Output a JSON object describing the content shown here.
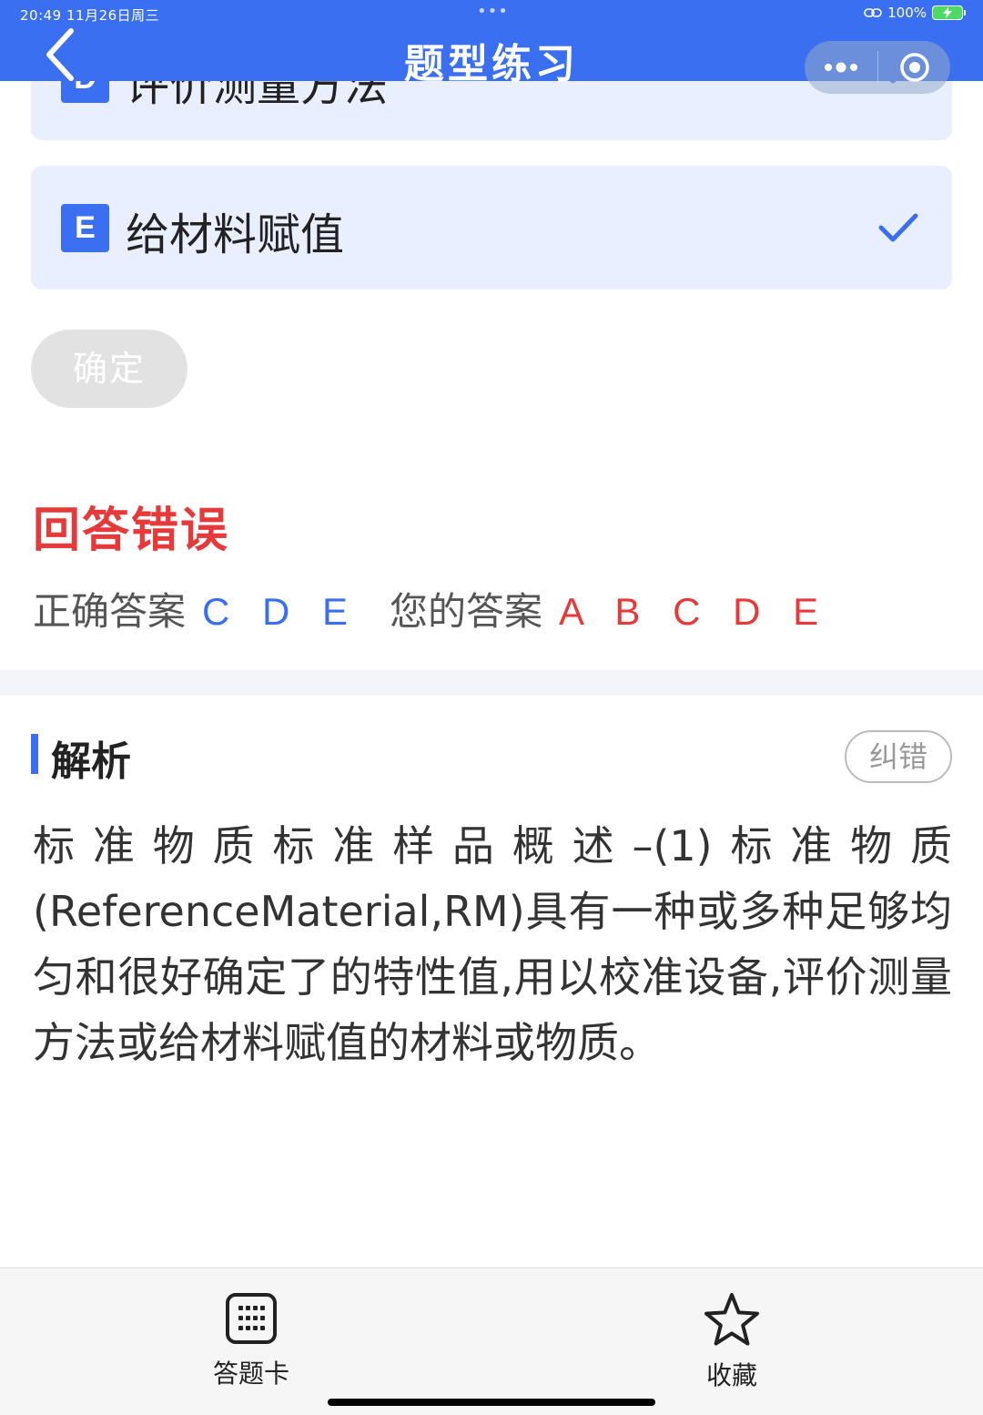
{
  "status_bar": {
    "time_date": "20:49  11月26日周三",
    "dots": "•••",
    "battery_text": "100%"
  },
  "nav": {
    "title": "题型练习"
  },
  "options": [
    {
      "letter": "D",
      "text": "评价测量方法",
      "selected": true
    },
    {
      "letter": "E",
      "text": "给材料赋值",
      "selected": true
    }
  ],
  "confirm_label": "确定",
  "result": {
    "title": "回答错误",
    "correct_label": "正确答案",
    "correct_value": "C D E",
    "yours_label": "您的答案",
    "yours_value": "A B C D E"
  },
  "analysis": {
    "title": "解析",
    "report_label": "纠错",
    "text": "标准物质标准样品概述–(1)标准物质(ReferenceMaterial,RM)具有一种或多种足够均匀和很好确定了的特性值,用以校准设备,评价测量方法或给材料赋值的材料或物质。"
  },
  "tabbar": {
    "card_label": "答题卡",
    "favorite_label": "收藏"
  },
  "colors": {
    "primary": "#3a6ff2",
    "error": "#e8393a",
    "option_bg": "#e9efff"
  }
}
